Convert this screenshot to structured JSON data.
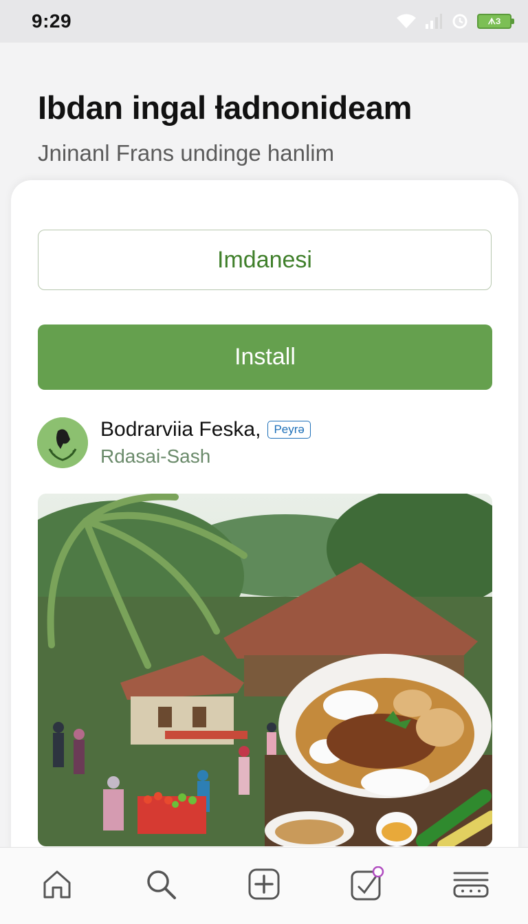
{
  "status": {
    "time": "9:29",
    "battery_label": "ᗑЗ"
  },
  "header": {
    "title": "Ɩbdan ingal ƚadnonideam",
    "subtitle": "Jninanl Frans undinge hanlim pleruingeary Sufd."
  },
  "card": {
    "language_label": "Imdanesi",
    "install_label": "Install",
    "developer": {
      "name": "Bodrarviia Feska,",
      "badge": "Peyrə",
      "subtitle": "Rdasai-Sash"
    }
  },
  "bottom_nav": {
    "items": [
      "home-icon",
      "search-icon",
      "add-icon",
      "edit-icon",
      "menu-icon"
    ]
  },
  "colors": {
    "accent": "#65a04e",
    "accent_text": "#3f7f2a",
    "badge": "#1d6fb8"
  }
}
